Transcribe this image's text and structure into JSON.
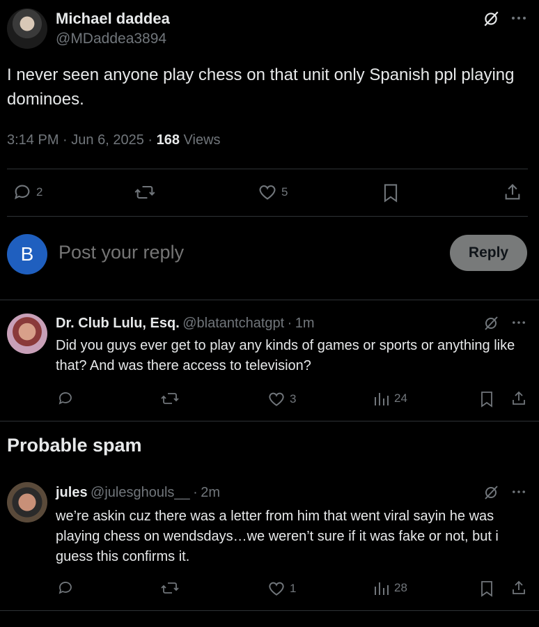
{
  "main_post": {
    "display_name": "Michael daddea",
    "handle": "@MDaddea3894",
    "text": "I never seen anyone play chess on that unit only Spanish ppl playing dominoes.",
    "time": "3:14 PM",
    "date": "Jun 6, 2025",
    "views_count": "168",
    "views_label": "Views",
    "replies": "2",
    "likes": "5"
  },
  "composer": {
    "avatar_letter": "B",
    "placeholder": "Post your reply",
    "reply_label": "Reply"
  },
  "replies": [
    {
      "display_name": "Dr. Club Lulu, Esq.",
      "handle": "@blatantchatgpt",
      "age": "1m",
      "text": "Did you guys ever get to play any kinds of games or sports or anything like that? And was there access to television?",
      "likes": "3",
      "views": "24"
    },
    {
      "display_name": "jules",
      "handle": "@julesghouls__",
      "age": "2m",
      "text": "we’re askin cuz there was a letter from him that went viral sayin he was playing chess on wendsdays…we weren’t sure if it was fake or not, but i guess this confirms it.",
      "likes": "1",
      "views": "28"
    }
  ],
  "section": {
    "spam_title": "Probable spam"
  },
  "separators": {
    "dot": "·"
  },
  "icons": {
    "grok": "grok-icon",
    "more": "more-icon",
    "reply": "reply-icon",
    "repost": "repost-icon",
    "like": "like-icon",
    "bookmark": "bookmark-icon",
    "share": "share-icon",
    "views": "views-icon"
  },
  "colors": {
    "background": "#000000",
    "text": "#e7e9ea",
    "muted": "#71767b",
    "divider": "#2f3336",
    "avatar_blue": "#1f5fbf",
    "reply_button": "#787a7a"
  }
}
